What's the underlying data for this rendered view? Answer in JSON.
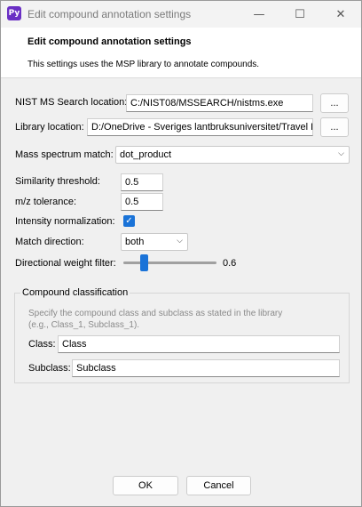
{
  "window": {
    "app_icon_text": "Py",
    "title": "Edit compound annotation settings",
    "minimize": "—",
    "maximize": "☐",
    "close": "✕"
  },
  "header": {
    "title": "Edit compound annotation settings",
    "description": "This settings uses the MSP library to annotate compounds."
  },
  "form": {
    "nist_label": "NIST MS Search location:",
    "nist_value": "C:/NIST08/MSSEARCH/nistms.exe",
    "browse_label": "...",
    "library_label": "Library location:",
    "library_value": "D:/OneDrive - Sveriges lantbruksuniversitet/Travel Re",
    "mass_match_label": "Mass spectrum match:",
    "mass_match_value": "dot_product",
    "similarity_label": "Similarity threshold:",
    "similarity_value": "0.5",
    "mz_label": "m/z tolerance:",
    "mz_value": "0.5",
    "intensity_label": "Intensity normalization:",
    "intensity_checked": true,
    "direction_label": "Match direction:",
    "direction_value": "both",
    "weight_label": "Directional weight filter:",
    "weight_value": "0.6",
    "weight_fraction": 0.6
  },
  "classification": {
    "title": "Compound classification",
    "hint_line1": "Specify the compound class and subclass as stated in the library",
    "hint_line2": "(e.g., Class_1, Subclass_1).",
    "class_label": "Class:",
    "class_value": "Class",
    "subclass_label": "Subclass:",
    "subclass_value": "Subclass"
  },
  "buttons": {
    "ok": "OK",
    "cancel": "Cancel"
  },
  "colors": {
    "accent": "#1a73d8",
    "app_icon": "#6a2fc4"
  }
}
